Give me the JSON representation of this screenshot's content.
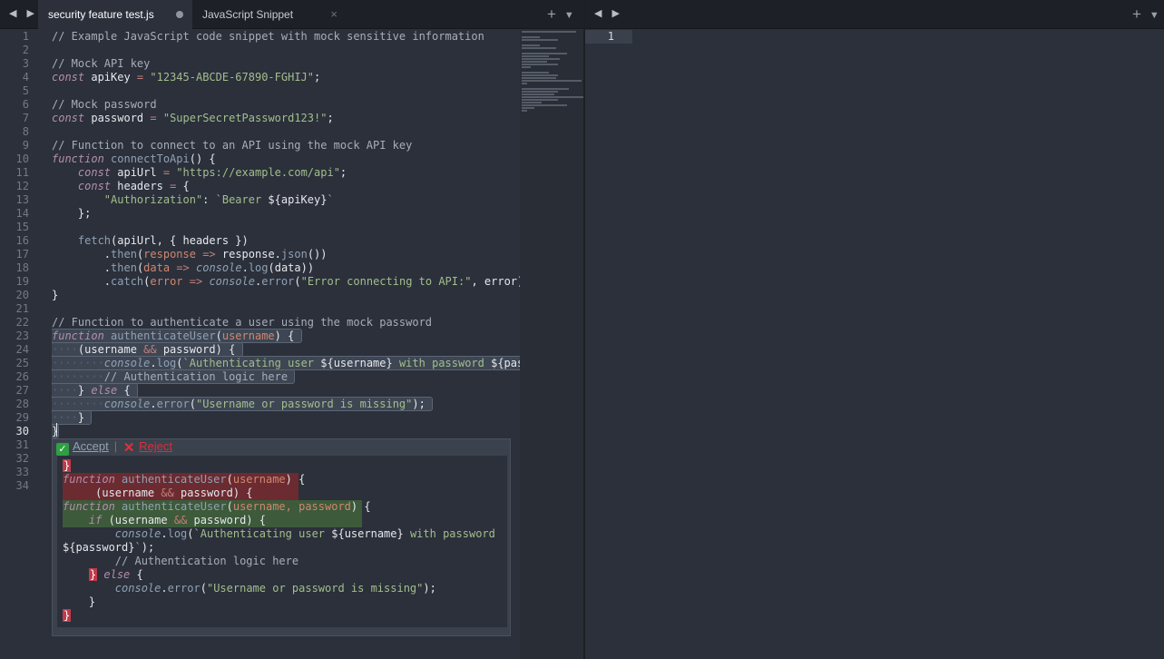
{
  "left_pane": {
    "tabs": [
      {
        "label": "security feature test.js",
        "active": true,
        "modified": true
      },
      {
        "label": "JavaScript Snippet",
        "active": false,
        "modified": false
      }
    ],
    "line_numbers": [
      "1",
      "2",
      "3",
      "4",
      "5",
      "6",
      "7",
      "8",
      "9",
      "10",
      "11",
      "12",
      "13",
      "14",
      "15",
      "16",
      "17",
      "18",
      "19",
      "20",
      "21",
      "22",
      "23",
      "24",
      "25",
      "26",
      "27",
      "28",
      "29",
      "30",
      "31",
      "32",
      "33",
      "34"
    ],
    "active_line": "30",
    "diff": {
      "accept_label": "Accept",
      "separator": "|",
      "reject_label": "Reject"
    }
  },
  "right_pane": {
    "line_numbers": [
      "1"
    ]
  },
  "icons": {
    "nav": "◀ ▶",
    "new_tab": "+",
    "tab_menu": "▼",
    "close": "×",
    "accept": "✓",
    "reject": "✕"
  },
  "colors": {
    "background": "#2b303b",
    "tabbar": "#1d2127",
    "comment": "#a7adba",
    "keyword": "#b48ead",
    "string": "#a3be8c",
    "function": "#8fa1b3",
    "param": "#d08770",
    "diff_deleted": "#6b2b31",
    "diff_added": "#3d5a3a",
    "accept_badge": "#2ea043",
    "reject_badge": "#e0303a"
  }
}
